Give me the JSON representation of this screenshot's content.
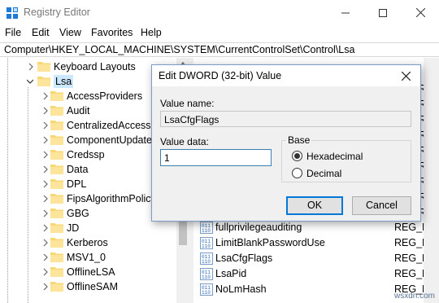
{
  "window": {
    "title": "Registry Editor",
    "icon": "regedit-icon"
  },
  "menu": {
    "items": [
      "File",
      "Edit",
      "View",
      "Favorites",
      "Help"
    ]
  },
  "address": {
    "path": "Computer\\HKEY_LOCAL_MACHINE\\SYSTEM\\CurrentControlSet\\Control\\Lsa"
  },
  "tree": {
    "items": [
      {
        "label": "Keyboard Layouts"
      },
      {
        "label": "Lsa"
      },
      {
        "label": "AccessProviders"
      },
      {
        "label": "Audit"
      },
      {
        "label": "CentralizedAccessPo"
      },
      {
        "label": "ComponentUpdates"
      },
      {
        "label": "Credssp"
      },
      {
        "label": "Data"
      },
      {
        "label": "DPL"
      },
      {
        "label": "FipsAlgorithmPolicy"
      },
      {
        "label": "GBG"
      },
      {
        "label": "JD"
      },
      {
        "label": "Kerberos"
      },
      {
        "label": "MSV1_0"
      },
      {
        "label": "OfflineLSA"
      },
      {
        "label": "OfflineSAM"
      }
    ]
  },
  "values": {
    "rows": [
      {
        "name": "fullprivilegeauditing",
        "type": "REG_BI"
      },
      {
        "name": "LimitBlankPasswordUse",
        "type": "REG_DV"
      },
      {
        "name": "LsaCfgFlags",
        "type": "REG_DV"
      },
      {
        "name": "LsaPid",
        "type": "REG_DV"
      },
      {
        "name": "NoLmHash",
        "type": "REG_DV"
      }
    ],
    "partial_types": [
      "REG_",
      "REG_",
      "REG_",
      "REG_",
      "REG_",
      "REG_",
      "REG_",
      "REG_",
      "REG_"
    ]
  },
  "dialog": {
    "title": "Edit DWORD (32-bit) Value",
    "value_name_label": "Value name:",
    "value_name": "LsaCfgFlags",
    "value_data_label": "Value data:",
    "value_data": "1",
    "base_label": "Base",
    "hex_label": "Hexadecimal",
    "dec_label": "Decimal",
    "selected_base": "Hexadecimal",
    "ok_label": "OK",
    "cancel_label": "Cancel"
  },
  "watermark": "wsxdn.com",
  "colors": {
    "folder": "#f8d775",
    "focus": "#0078d7",
    "reg_icon_blue": "#2e6fbd"
  }
}
